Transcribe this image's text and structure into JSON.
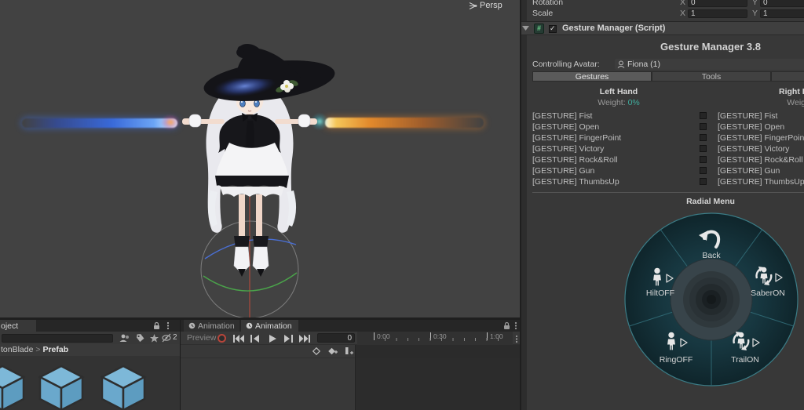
{
  "scene": {
    "persp": "Persp"
  },
  "project": {
    "tab": "oject",
    "hidden_count": "2",
    "breadcrumb": {
      "parent": "tonBlade",
      "separator": ">",
      "current": "Prefab"
    }
  },
  "animation": {
    "tabs": [
      "Animation",
      "Animation"
    ],
    "preview": "Preview",
    "frame": "0",
    "ruler": [
      "0:00",
      "0:30",
      "1:00"
    ]
  },
  "inspector": {
    "transform": {
      "rotation_label": "Rotation",
      "scale_label": "Scale",
      "x_label": "X",
      "y_label": "Y",
      "rotation_x": "0",
      "rotation_y": "0",
      "scale_x": "1",
      "scale_y": "1"
    },
    "component": {
      "title": "Gesture Manager (Script)"
    },
    "title": "Gesture Manager 3.8",
    "avatar": {
      "label": "Controlling Avatar:",
      "value": "Fiona (1)"
    },
    "tabs": [
      "Gestures",
      "Tools",
      ""
    ],
    "hands": {
      "left": {
        "title": "Left Hand",
        "weight_label": "Weight:",
        "weight": "0%"
      },
      "right": {
        "title": "Right Hand",
        "weight_label": "Weight:",
        "weight": ""
      }
    },
    "gestures": [
      "[GESTURE] Fist",
      "[GESTURE] Open",
      "[GESTURE] FingerPoint",
      "[GESTURE] Victory",
      "[GESTURE] Rock&Roll",
      "[GESTURE] Gun",
      "[GESTURE] ThumbsUp"
    ],
    "radial": {
      "title": "Radial Menu",
      "items": [
        {
          "label": "Back",
          "icon": "back-arrow"
        },
        {
          "label": "HiltOFF",
          "icon": "person"
        },
        {
          "label": "SaberON",
          "icon": "person-rotate"
        },
        {
          "label": "RingOFF",
          "icon": "person"
        },
        {
          "label": "TrailON",
          "icon": "person-rotate"
        }
      ]
    }
  },
  "colors": {
    "weight_accent": "#3fae9f",
    "wheel_border": "#3b7c86",
    "cube_blue": "#6aabcf",
    "record_red": "#b8453a"
  }
}
